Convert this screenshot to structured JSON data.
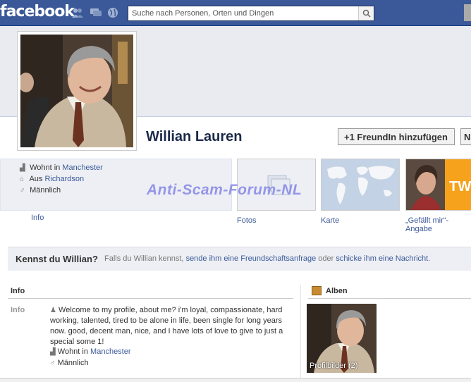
{
  "topbar": {
    "logo": "facebook",
    "search_placeholder": "Suche nach Personen, Orten und Dingen"
  },
  "profile": {
    "name": "Willian Lauren",
    "add_friend_label": "+1 FreundIn hinzufügen",
    "message_label": "N"
  },
  "intro": {
    "lives_prefix": "Wohnt in",
    "lives_city": "Manchester",
    "from_prefix": "Aus",
    "from_city": "Richardson",
    "gender": "Männlich"
  },
  "tiles": {
    "info": "Info",
    "photos": "Fotos",
    "map": "Karte",
    "likes": "„Gefällt mir“-Angabe",
    "like_logo": "TW"
  },
  "watermark": "Anti-Scam-Forum-NL",
  "know": {
    "title": "Kennst du Willian?",
    "text_1": "Falls du Willian kennst,",
    "link_1": "sende ihm eine Freundschaftsanfrage",
    "text_2": "oder",
    "link_2": "schicke ihm eine Nachricht",
    "text_3": "."
  },
  "info_section": {
    "heading": "Info",
    "label": "Info",
    "about": "Welcome to my profile, about me? i'm loyal, compassionate, hard working, talented, tired to be alone in life, been single for long years now. good, decent man, nice, and I have lots of love to give to just a special some 1!",
    "lives_prefix": "Wohnt in",
    "lives_city": "Manchester",
    "gender": "Männlich"
  },
  "albums_section": {
    "heading": "Alben",
    "album_caption": "Profilbilder (2)"
  },
  "colors": {
    "brand": "#3b5998",
    "panel": "#edeff4",
    "watermark": "#8c8ce8"
  }
}
